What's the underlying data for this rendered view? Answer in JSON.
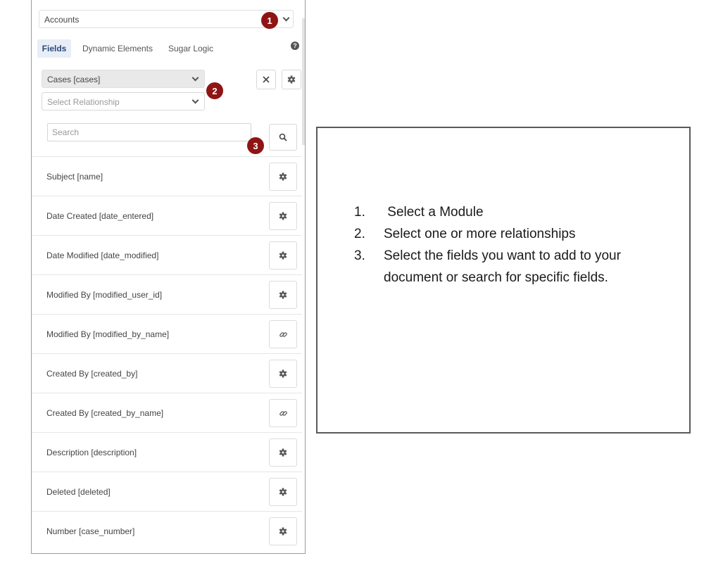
{
  "module_select": {
    "label": "Accounts"
  },
  "badges": [
    "1",
    "2",
    "3"
  ],
  "tabs": [
    {
      "label": "Fields",
      "active": true
    },
    {
      "label": "Dynamic Elements",
      "active": false
    },
    {
      "label": "Sugar Logic",
      "active": false
    }
  ],
  "relationships": {
    "module": "Cases [cases]",
    "placeholder": "Select Relationship"
  },
  "search": {
    "placeholder": "Search"
  },
  "fields": [
    {
      "label": "Subject [name]",
      "icon": "gear-icon"
    },
    {
      "label": "Date Created [date_entered]",
      "icon": "gear-icon"
    },
    {
      "label": "Date Modified [date_modified]",
      "icon": "gear-icon"
    },
    {
      "label": "Modified By [modified_user_id]",
      "icon": "gear-icon"
    },
    {
      "label": "Modified By [modified_by_name]",
      "icon": "link-icon"
    },
    {
      "label": "Created By [created_by]",
      "icon": "gear-icon"
    },
    {
      "label": "Created By [created_by_name]",
      "icon": "link-icon"
    },
    {
      "label": "Description [description]",
      "icon": "gear-icon"
    },
    {
      "label": "Deleted [deleted]",
      "icon": "gear-icon"
    },
    {
      "label": "Number [case_number]",
      "icon": "gear-icon"
    }
  ],
  "instructions": {
    "steps": [
      {
        "num": "1.",
        "text": " Select a Module"
      },
      {
        "num": "2.",
        "text": "Select one or more relationships"
      },
      {
        "num": "3.",
        "text": "Select the fields you want to add to your document or search for specific fields."
      }
    ]
  },
  "colors": {
    "badge": "#8f1414",
    "tab_active_bg": "#e8eef7",
    "select_bg": "#e9e9e9"
  }
}
